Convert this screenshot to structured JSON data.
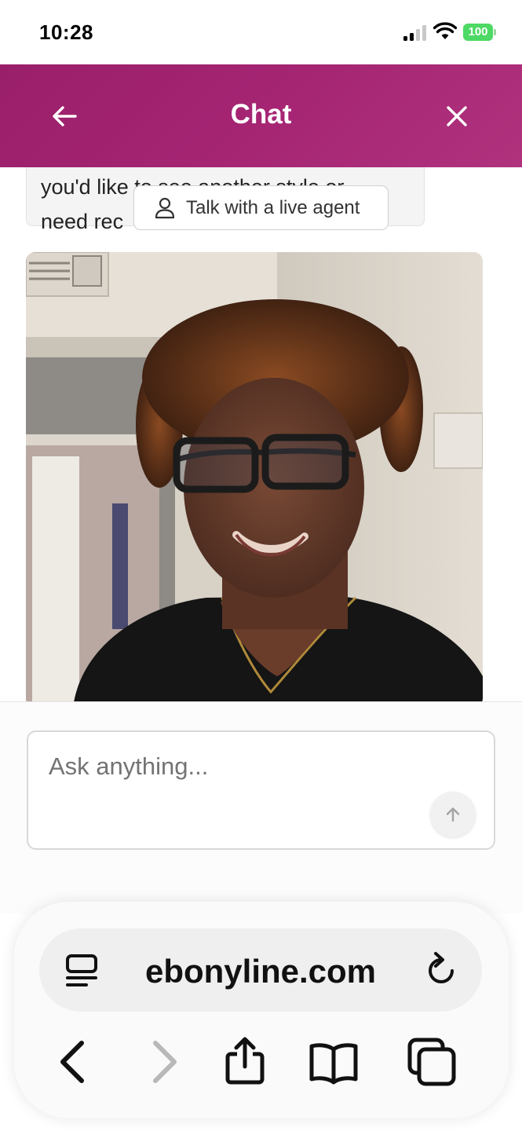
{
  "status_bar": {
    "time": "10:28",
    "battery": "100"
  },
  "header": {
    "title": "Chat",
    "back_icon": "arrow-left-icon",
    "close_icon": "close-icon",
    "gradient": [
      "#9a1f6a",
      "#b0327d"
    ]
  },
  "chat": {
    "bot_message_partial": "you'd like to see another style or\nneed rec",
    "agent_button_label": "Talk with a live agent",
    "photo": "selfie of a smiling woman with curly auburn hair and glasses"
  },
  "composer": {
    "placeholder": "Ask anything...",
    "send_icon": "arrow-up-icon"
  },
  "browser": {
    "url": "ebonyline.com",
    "toolbar_icons": [
      "back-icon",
      "forward-icon",
      "share-icon",
      "bookmarks-icon",
      "tabs-icon"
    ]
  }
}
